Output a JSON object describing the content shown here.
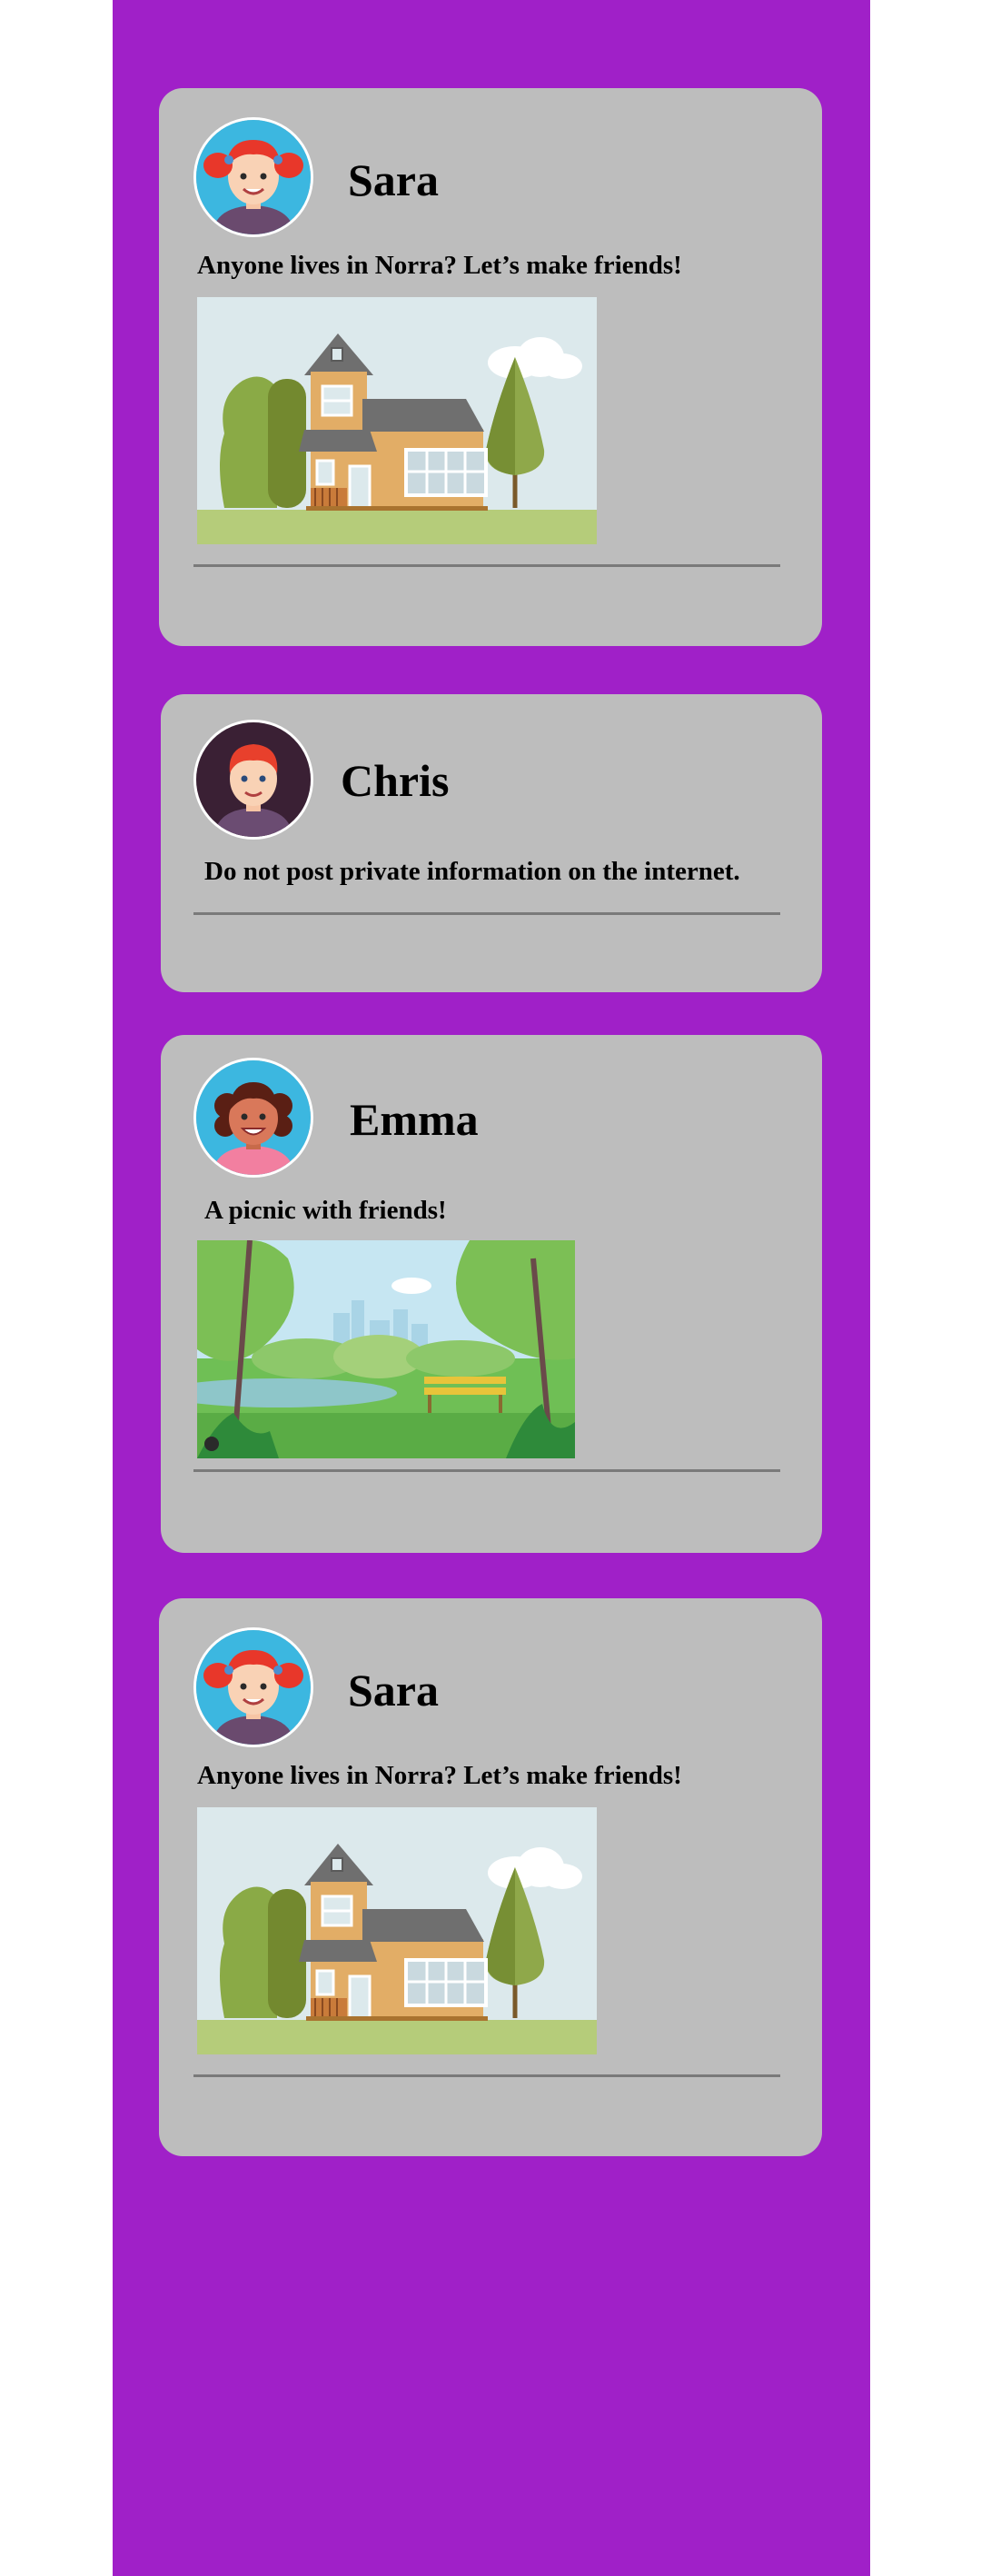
{
  "colors": {
    "background": "#a020c8",
    "card": "#bdbdbd",
    "divider": "#7a7a7a"
  },
  "posts": [
    {
      "author": "Sara",
      "avatar": "girl-red-pigtails-avatar",
      "text": "Anyone lives in Norra? Let’s make friends!",
      "image": "house-illustration"
    },
    {
      "author": "Chris",
      "avatar": "boy-red-hair-avatar",
      "text": "Do not post private information on the internet."
    },
    {
      "author": "Emma",
      "avatar": "girl-curly-hair-avatar",
      "text": "A picnic with friends!",
      "image": "park-illustration"
    },
    {
      "author": "Sara",
      "avatar": "girl-red-pigtails-avatar",
      "text": "Anyone lives in Norra? Let’s make friends!",
      "image": "house-illustration"
    }
  ]
}
